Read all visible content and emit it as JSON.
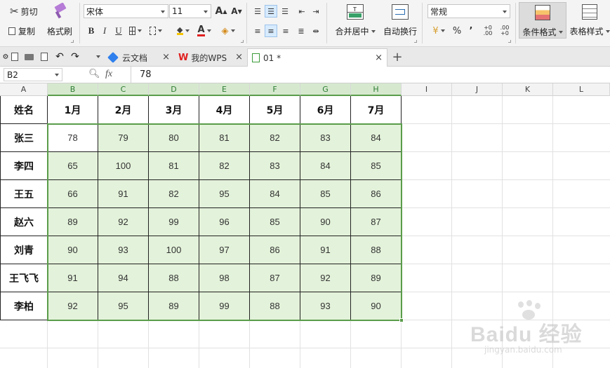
{
  "ribbon": {
    "cut_label": "剪切",
    "copy_label": "复制",
    "format_painter_label": "格式刷",
    "font_name": "宋体",
    "font_size": "11",
    "font_grow": "A",
    "font_shrink": "A",
    "bold": "B",
    "italic": "I",
    "underline": "U",
    "font_color_letter": "A",
    "merge_center_label": "合并居中",
    "wrap_text_label": "自动换行",
    "number_format": "常规",
    "percent_symbol": "%",
    "comma_symbol": "’",
    "decimal_increase": "+0 .00",
    "decimal_decrease": ".00 +0",
    "conditional_format_label": "条件格式",
    "table_style_label": "表格样式"
  },
  "tabs": [
    {
      "label": "云文档",
      "icon": "cloud-doc-icon",
      "close": "×"
    },
    {
      "label": "我的WPS",
      "icon": "wps-logo-icon",
      "close": "×"
    },
    {
      "label": "01 *",
      "icon": "spreadsheet-icon",
      "close": "×",
      "active": true
    }
  ],
  "tab_add": "+",
  "formula_bar": {
    "cell_ref": "B2",
    "fx_label": "fx",
    "value": "78"
  },
  "columns": [
    "A",
    "B",
    "C",
    "D",
    "E",
    "F",
    "G",
    "H",
    "I",
    "J",
    "K",
    "L"
  ],
  "selected_columns": [
    "B",
    "C",
    "D",
    "E",
    "F",
    "G",
    "H"
  ],
  "table": {
    "header": [
      "姓名",
      "1月",
      "2月",
      "3月",
      "4月",
      "5月",
      "6月",
      "7月"
    ],
    "rows": [
      {
        "name": "张三",
        "values": [
          "78",
          "79",
          "80",
          "81",
          "82",
          "83",
          "84"
        ]
      },
      {
        "name": "李四",
        "values": [
          "65",
          "100",
          "81",
          "82",
          "83",
          "84",
          "85"
        ]
      },
      {
        "name": "王五",
        "values": [
          "66",
          "91",
          "82",
          "95",
          "84",
          "85",
          "86"
        ]
      },
      {
        "name": "赵六",
        "values": [
          "89",
          "92",
          "99",
          "96",
          "85",
          "90",
          "87"
        ]
      },
      {
        "name": "刘青",
        "values": [
          "90",
          "93",
          "100",
          "97",
          "86",
          "91",
          "88"
        ]
      },
      {
        "name": "王飞飞",
        "values": [
          "91",
          "94",
          "88",
          "98",
          "87",
          "92",
          "89"
        ]
      },
      {
        "name": "李柏",
        "values": [
          "92",
          "95",
          "89",
          "99",
          "88",
          "93",
          "90"
        ]
      }
    ]
  },
  "watermark": {
    "brand": "Baidu 经验",
    "url": "jingyan.baidu.com"
  },
  "colors": {
    "selection_fill": "#e3f2da",
    "selection_border": "#5a9c4a",
    "header_highlight": "#d6e9cf"
  }
}
